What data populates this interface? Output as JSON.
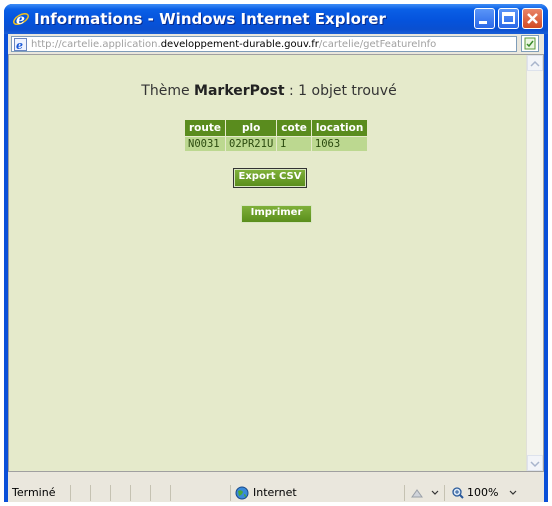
{
  "window": {
    "title": "Informations - Windows Internet Explorer"
  },
  "address": {
    "url_prefix": "http://cartelie.application.",
    "url_domain": "developpement-durable.gouv.fr",
    "url_path": "/cartelie/getFeatureInfo"
  },
  "content": {
    "heading_prefix": "Thème ",
    "heading_theme": "MarkerPost",
    "heading_suffix": " : 1 objet trouvé",
    "table": {
      "headers": [
        "route",
        "plo",
        "cote",
        "location"
      ],
      "rows": [
        [
          "N0031",
          "02PR21U",
          "I",
          "1063"
        ]
      ]
    },
    "export_button": "Export CSV",
    "print_button": "Imprimer"
  },
  "status": {
    "left_text": "Terminé",
    "zone": "Internet",
    "zoom": "100%"
  },
  "colors": {
    "content_bg": "#e5eacb",
    "table_header": "#5a8c1e",
    "table_cell": "#bcd890",
    "button": "#6a9e28"
  }
}
